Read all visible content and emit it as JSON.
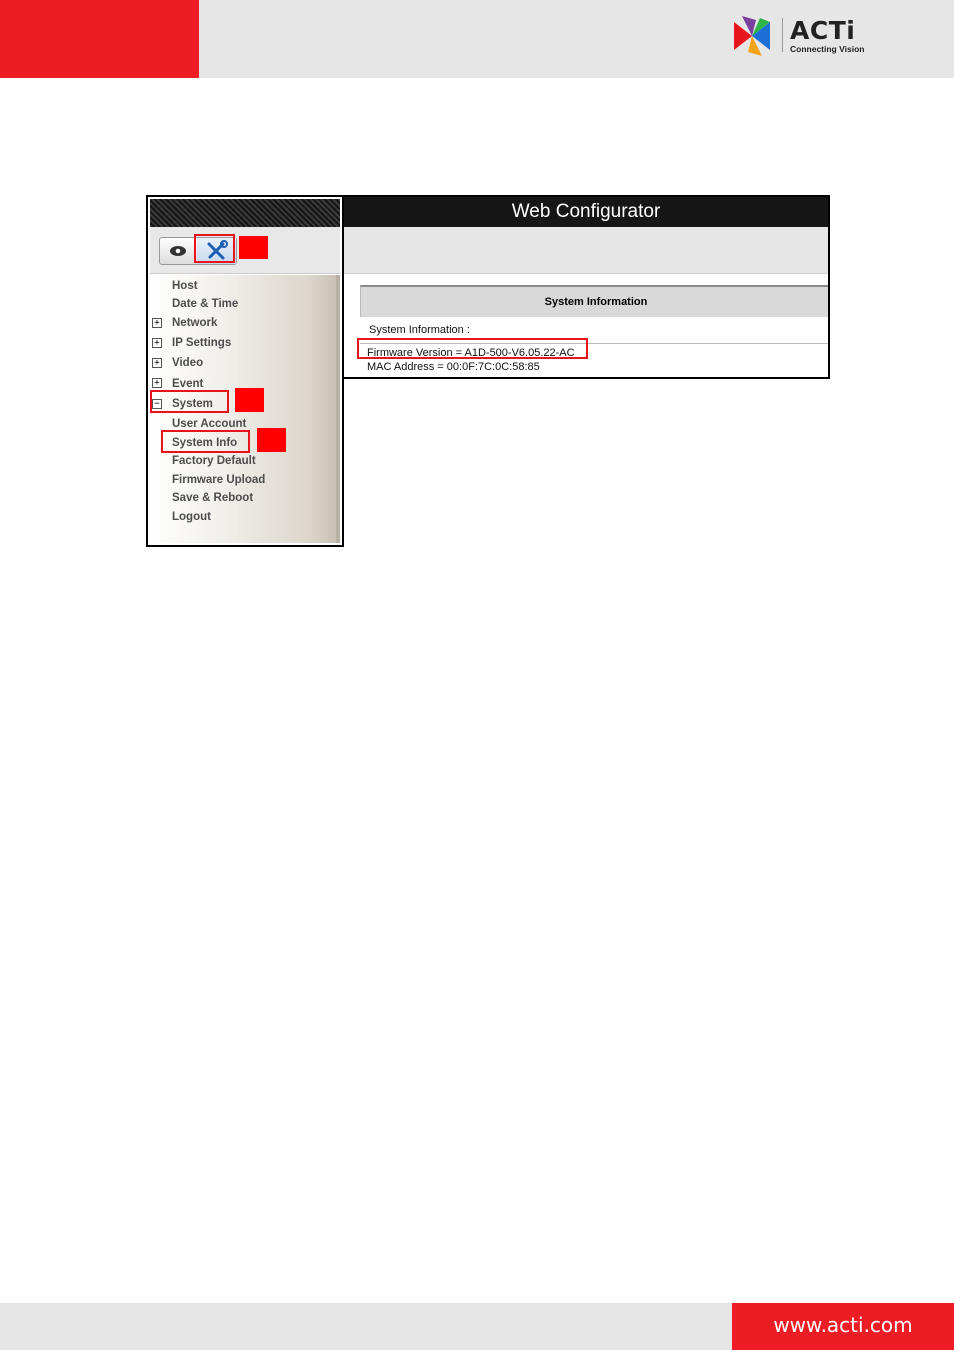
{
  "header": {
    "brand_mark": "ACTi",
    "brand_tagline": "Connecting Vision",
    "colors": {
      "accent_red": "#ee1c25",
      "bar_gray": "#e6e6e6"
    }
  },
  "footer": {
    "url": "www.acti.com"
  },
  "configurator": {
    "title": "Web Configurator",
    "toolbar": {
      "view_icon": "eye-icon",
      "setup_icon": "tools-icon"
    },
    "menu": [
      {
        "label": "Host",
        "expander": ""
      },
      {
        "label": "Date & Time",
        "expander": ""
      },
      {
        "label": "Network",
        "expander": "+"
      },
      {
        "label": "IP Settings",
        "expander": "+"
      },
      {
        "label": "Video",
        "expander": "+"
      },
      {
        "label": "Event",
        "expander": "+"
      },
      {
        "label": "System",
        "expander": "−"
      },
      {
        "label": "User Account",
        "expander": ""
      },
      {
        "label": "System Info",
        "expander": ""
      },
      {
        "label": "Factory Default",
        "expander": ""
      },
      {
        "label": "Firmware Upload",
        "expander": ""
      },
      {
        "label": "Save & Reboot",
        "expander": ""
      },
      {
        "label": "Logout",
        "expander": ""
      }
    ],
    "system_info": {
      "header": "System Information",
      "label": "System Information :",
      "firmware_version": "Firmware Version = A1D-500-V6.05.22-AC",
      "mac_address": "MAC Address = 00:0F:7C:0C:58:85"
    }
  }
}
